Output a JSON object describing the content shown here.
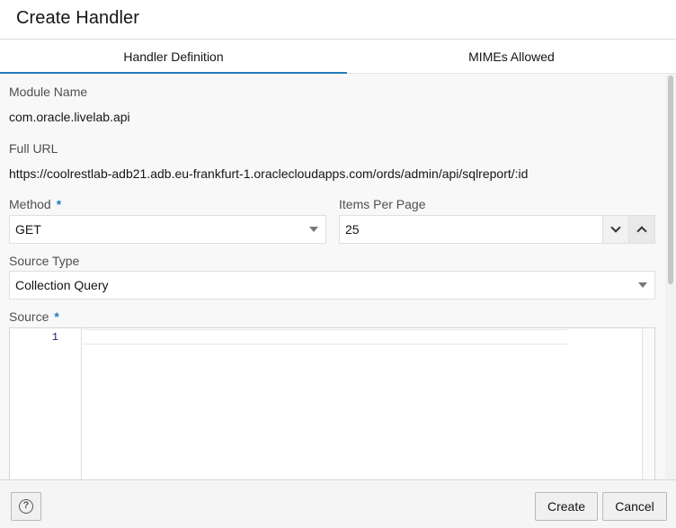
{
  "dialog": {
    "title": "Create Handler"
  },
  "tabs": [
    {
      "label": "Handler Definition",
      "active": true
    },
    {
      "label": "MIMEs Allowed",
      "active": false
    }
  ],
  "form": {
    "module_name": {
      "label": "Module Name",
      "value": "com.oracle.livelab.api"
    },
    "full_url": {
      "label": "Full URL",
      "value": "https://coolrestlab-adb21.adb.eu-frankfurt-1.oraclecloudapps.com/ords/admin/api/sqlreport/:id"
    },
    "method": {
      "label": "Method",
      "required_mark": "*",
      "value": "GET"
    },
    "items_per_page": {
      "label": "Items Per Page",
      "value": "25"
    },
    "source_type": {
      "label": "Source Type",
      "value": "Collection Query"
    },
    "source": {
      "label": "Source",
      "required_mark": "*",
      "line_number": "1"
    }
  },
  "footer": {
    "help_icon": "?",
    "create_label": "Create",
    "cancel_label": "Cancel"
  },
  "colors": {
    "accent": "#227bbd",
    "border": "#dfdfdf",
    "footer_bg": "#f5f5f5"
  },
  "icons": [
    "chevron-down-icon",
    "chevron-up-icon",
    "caret-down-icon",
    "help-icon"
  ]
}
